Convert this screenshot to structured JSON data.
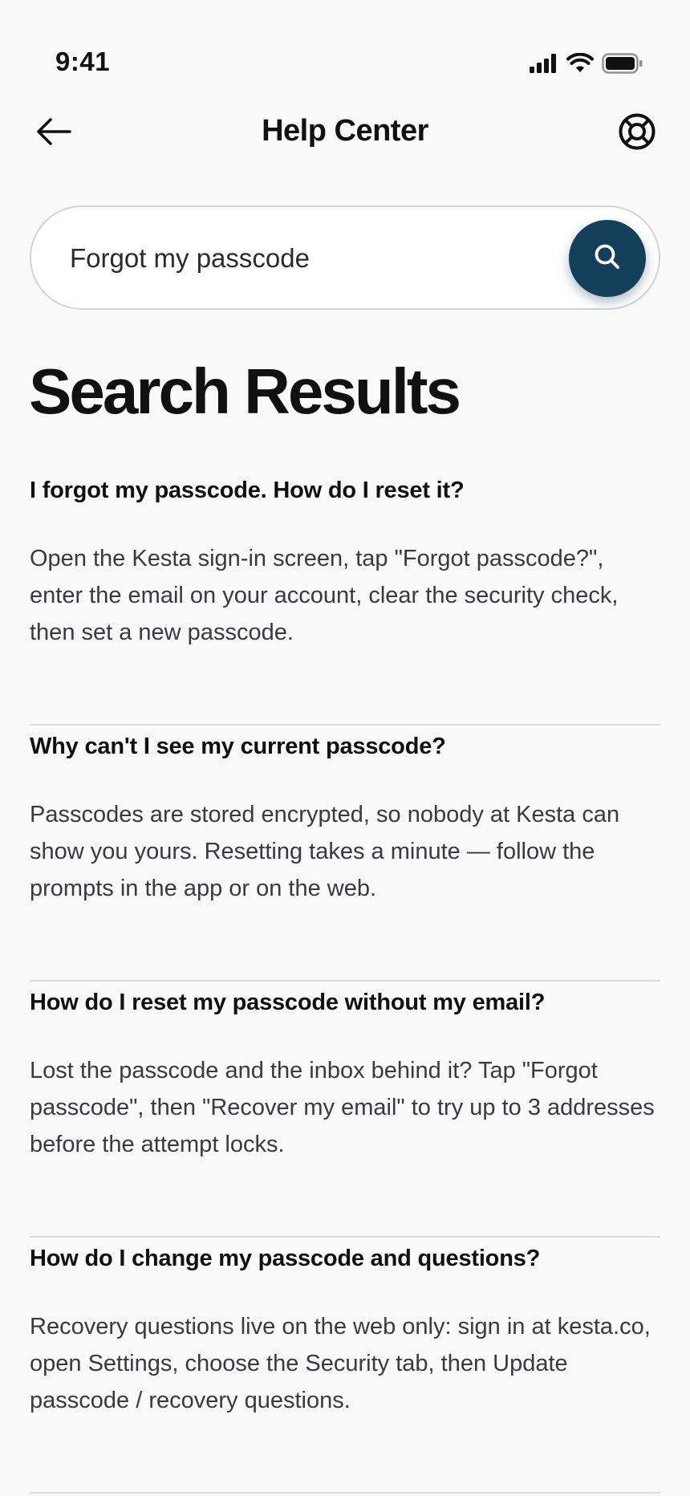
{
  "status_bar": {
    "time": "9:41"
  },
  "nav": {
    "title": "Help Center",
    "back_icon": "arrow-left-icon",
    "help_icon": "lifebuoy-icon"
  },
  "search": {
    "value": "Forgot my passcode",
    "button_color": "#133f5b"
  },
  "results": {
    "title": "Search Results",
    "items": [
      {
        "question": "I forgot my passcode. How do I reset it?",
        "answer": "Open the Kesta sign-in screen, tap \"Forgot passcode?\", enter the email on your account, clear the security check, then set a new passcode."
      },
      {
        "question": "Why can't I see my current passcode?",
        "answer": "Passcodes are stored encrypted, so nobody at Kesta can show you yours. Resetting takes a minute — follow the prompts in the app or on the web."
      },
      {
        "question": "How do I reset my passcode without my email?",
        "answer": "Lost the passcode and the inbox behind it? Tap \"Forgot passcode\", then \"Recover my email\" to try up to 3 addresses before the attempt locks."
      },
      {
        "question": "How do I change my passcode and questions?",
        "answer": "Recovery questions live on the web only: sign in at kesta.co, open Settings, choose the Security tab, then Update passcode / recovery questions."
      }
    ]
  }
}
